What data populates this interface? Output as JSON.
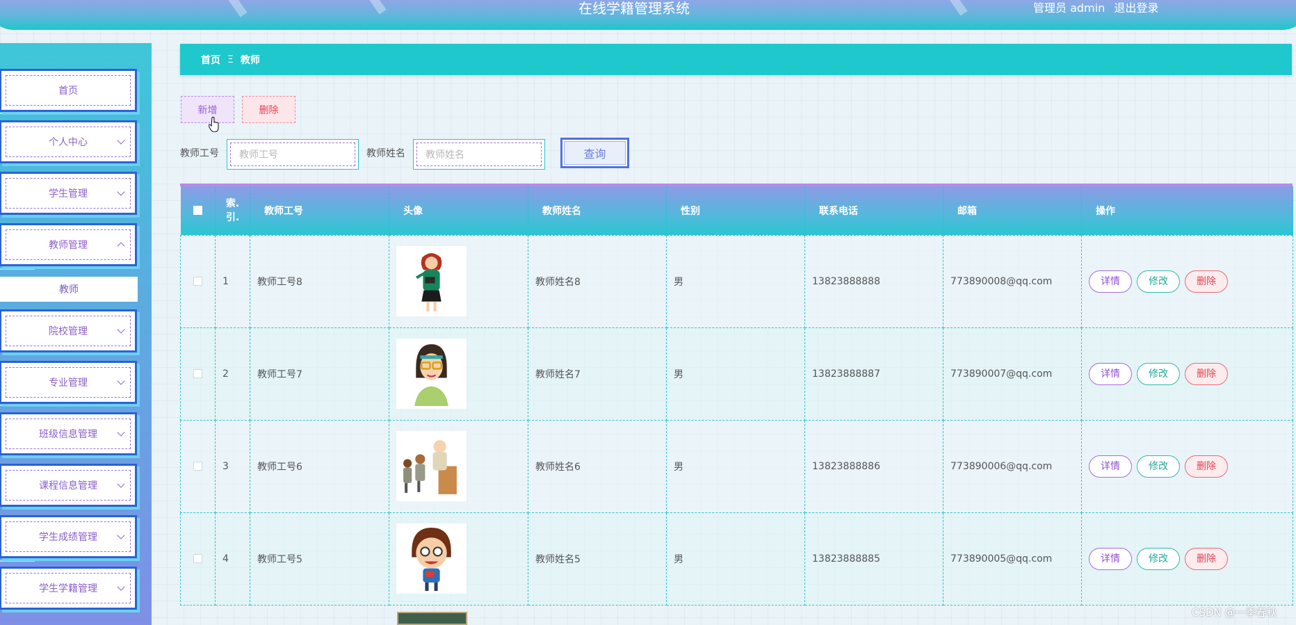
{
  "header": {
    "title": "在线学籍管理系统",
    "user_label": "管理员 admin",
    "logout_label": "退出登录"
  },
  "sidebar": {
    "items": [
      {
        "label": "首页",
        "expandable": false
      },
      {
        "label": "个人中心",
        "expandable": true
      },
      {
        "label": "学生管理",
        "expandable": true
      },
      {
        "label": "教师管理",
        "expandable": true,
        "expanded": true
      },
      {
        "label": "院校管理",
        "expandable": true
      },
      {
        "label": "专业管理",
        "expandable": true
      },
      {
        "label": "班级信息管理",
        "expandable": true
      },
      {
        "label": "课程信息管理",
        "expandable": true
      },
      {
        "label": "学生成绩管理",
        "expandable": true
      },
      {
        "label": "学生学籍管理",
        "expandable": true
      }
    ],
    "sub_item": "教师"
  },
  "breadcrumb": {
    "home": "首页",
    "separator": "Ξ",
    "current": "教师"
  },
  "actions": {
    "add_label": "新增",
    "delete_label": "删除"
  },
  "search": {
    "id_label": "教师工号",
    "id_placeholder": "教师工号",
    "name_label": "教师姓名",
    "name_placeholder": "教师姓名",
    "query_label": "查询"
  },
  "table": {
    "columns": {
      "index": "索.\n引.",
      "teacher_id": "教师工号",
      "avatar": "头像",
      "teacher_name": "教师姓名",
      "gender": "性别",
      "phone": "联系电话",
      "email": "邮箱",
      "ops": "操作"
    },
    "row_actions": {
      "detail": "详情",
      "edit": "修改",
      "delete": "删除"
    },
    "rows": [
      {
        "index": "1",
        "teacher_id": "教师工号8",
        "teacher_name": "教师姓名8",
        "gender": "男",
        "phone": "13823888888",
        "email": "773890008@qq.com",
        "avatar": "teacher-woman-green-icon"
      },
      {
        "index": "2",
        "teacher_id": "教师工号7",
        "teacher_name": "教师姓名7",
        "gender": "男",
        "phone": "13823888887",
        "email": "773890007@qq.com",
        "avatar": "teacher-glasses-icon"
      },
      {
        "index": "3",
        "teacher_id": "教师工号6",
        "teacher_name": "教师姓名6",
        "gender": "男",
        "phone": "13823888886",
        "email": "773890006@qq.com",
        "avatar": "teacher-students-icon"
      },
      {
        "index": "4",
        "teacher_id": "教师工号5",
        "teacher_name": "教师姓名5",
        "gender": "男",
        "phone": "13823888885",
        "email": "773890005@qq.com",
        "avatar": "teacher-cartoon-icon"
      }
    ]
  },
  "watermark": "CSDN @一季春秋",
  "colors": {
    "accent": "#1ec8cc",
    "purple": "#9152d0",
    "danger": "#e0444f",
    "sidebar_border": "#2a62d6"
  }
}
